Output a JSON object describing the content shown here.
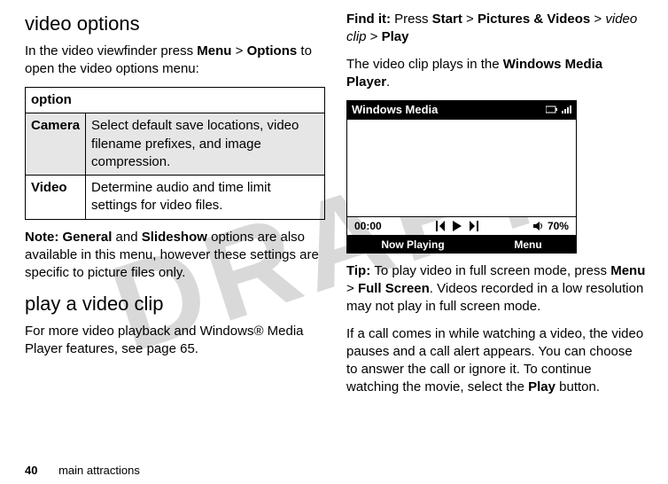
{
  "watermark": "DRAFT",
  "left": {
    "heading1": "video options",
    "intro_pre": "In the video viewfinder press ",
    "intro_menu": "Menu",
    "intro_gt": " > ",
    "intro_options": "Options",
    "intro_post": " to open the video options menu:",
    "table": {
      "header": "option",
      "rows": [
        {
          "label": "Camera",
          "desc": "Select default save locations, video filename prefixes, and image compression."
        },
        {
          "label": "Video",
          "desc": "Determine audio and time limit settings for video files."
        }
      ]
    },
    "note_label": "Note: ",
    "note_general": "General",
    "note_and": " and ",
    "note_slideshow": "Slideshow",
    "note_rest": " options are also available in this menu, however these settings are specific to picture files only.",
    "heading2": "play a video clip",
    "para2": "For more video playback and Windows® Media Player features, see page 65."
  },
  "right": {
    "findit_label": "Find it: ",
    "findit_press": "Press ",
    "findit_start": "Start",
    "findit_gt1": " > ",
    "findit_pv": "Pictures & Videos",
    "findit_gt2": " > ",
    "findit_clip": "video clip",
    "findit_gt3": " > ",
    "findit_play": "Play",
    "plays_pre": "The video clip plays in the ",
    "plays_wmp": "Windows Media Player",
    "plays_post": ".",
    "phone": {
      "title": "Windows Media",
      "time": "00:00",
      "vol": "70%",
      "soft_left": "Now Playing",
      "soft_right": "Menu"
    },
    "tip_label": "Tip: ",
    "tip_pre": "To play video in full screen mode, press ",
    "tip_menu": "Menu",
    "tip_gt": " > ",
    "tip_fs": "Full Screen",
    "tip_post": ". Videos recorded in a low resolution may not play in full screen mode.",
    "callpara_pre": "If a call comes in while watching a video, the video pauses and a call alert appears. You can choose to answer the call or ignore it. To continue watching the movie, select the ",
    "callpara_play": "Play",
    "callpara_post": " button."
  },
  "footer": {
    "page": "40",
    "section": "main attractions"
  }
}
